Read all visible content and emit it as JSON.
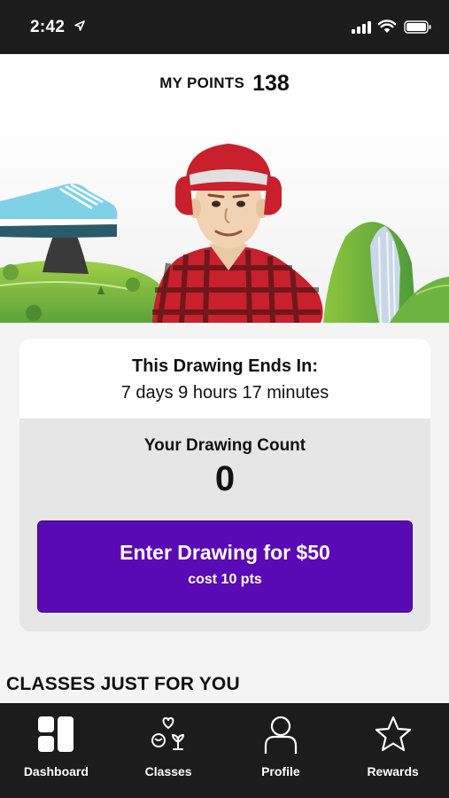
{
  "status_bar": {
    "time": "2:42",
    "icons": [
      "location-arrow-icon",
      "signal-bars-icon",
      "wifi-icon",
      "battery-icon"
    ]
  },
  "points": {
    "label": "MY POINTS",
    "value": "138"
  },
  "hero": {
    "illustration": "lumberjack-avatar-with-sneaker-island-and-waterfall"
  },
  "drawing": {
    "ends_title": "This Drawing Ends In:",
    "ends_time": "7 days 9 hours 17 minutes",
    "count_label": "Your Drawing Count",
    "count_value": "0",
    "enter_label": "Enter Drawing for $50",
    "enter_cost": "cost 10 pts"
  },
  "classes": {
    "title": "CLASSES JUST FOR YOU"
  },
  "tabs": [
    {
      "label": "Dashboard",
      "icon": "dashboard-grid-icon"
    },
    {
      "label": "Classes",
      "icon": "classes-icon"
    },
    {
      "label": "Profile",
      "icon": "person-icon"
    },
    {
      "label": "Rewards",
      "icon": "star-icon"
    }
  ],
  "colors": {
    "accent": "#5a0ab5",
    "bar": "#1c1c1c",
    "background": "#f4f4f4"
  }
}
